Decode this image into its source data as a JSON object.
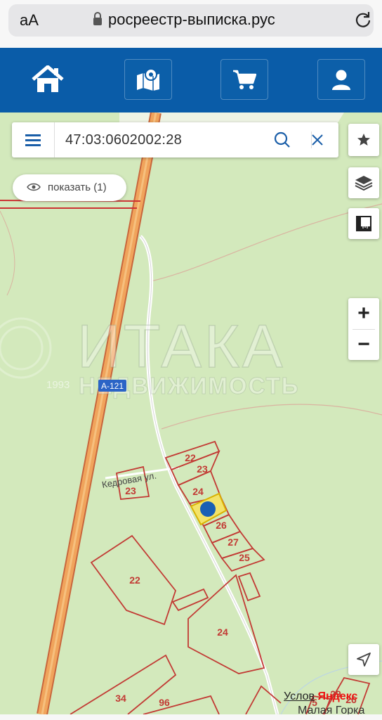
{
  "browser": {
    "text_size_label": "аА",
    "url": "росреестр-выписка.рус"
  },
  "nav": {
    "items": [
      {
        "name": "home",
        "icon": "home-icon"
      },
      {
        "name": "map",
        "icon": "map-pin-icon"
      },
      {
        "name": "cart",
        "icon": "cart-icon"
      },
      {
        "name": "profile",
        "icon": "user-icon"
      }
    ],
    "color": "#0a5ca8"
  },
  "search": {
    "value": "47:03:0602002:28"
  },
  "filter": {
    "show_label": "показать (1)"
  },
  "watermark": {
    "brand": "ИТАКА",
    "tagline": "НЕДВИЖИМОСТЬ",
    "year": "1993"
  },
  "map": {
    "road_label": "А-121",
    "street_label": "Кедровая ул.",
    "parcels": [
      "22",
      "23",
      "24",
      "26",
      "27",
      "25",
      "23",
      "22",
      "24",
      "34",
      "96",
      "5",
      "29",
      "26"
    ],
    "village": "Малая Горка",
    "attribution_terms": "Услов",
    "attribution_brand": "Яндекс"
  },
  "zoom": {
    "plus": "+",
    "minus": "−"
  }
}
